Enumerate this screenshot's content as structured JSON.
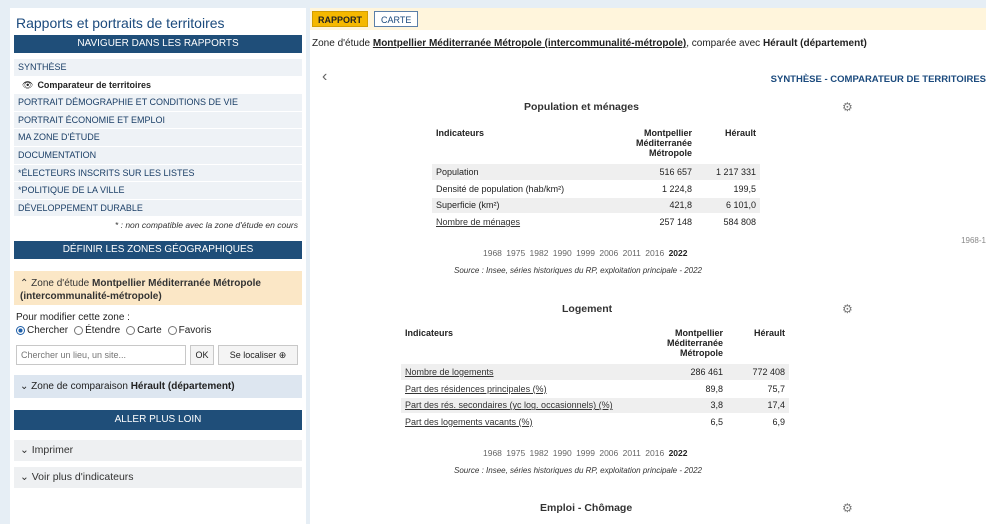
{
  "sidebar": {
    "title": "Rapports et portraits de territoires",
    "nav_header": "NAVIGUER DANS LES RAPPORTS",
    "nav_items": [
      {
        "label": "SYNTHÈSE",
        "type": "main"
      },
      {
        "label": "Comparateur de territoires",
        "type": "sub"
      },
      {
        "label": "PORTRAIT DÉMOGRAPHIE ET CONDITIONS DE VIE",
        "type": "main"
      },
      {
        "label": "PORTRAIT ÉCONOMIE ET EMPLOI",
        "type": "main"
      },
      {
        "label": "MA ZONE D'ÉTUDE",
        "type": "main"
      },
      {
        "label": "DOCUMENTATION",
        "type": "main"
      },
      {
        "label": "*ÉLECTEURS INSCRITS SUR LES LISTES",
        "type": "main"
      },
      {
        "label": "*POLITIQUE DE LA VILLE",
        "type": "main"
      },
      {
        "label": "DÉVELOPPEMENT DURABLE",
        "type": "main"
      }
    ],
    "nav_note": "* : non compatible avec la zone d'étude en cours",
    "zones_header": "DÉFINIR LES ZONES GÉOGRAPHIQUES",
    "zone_study_prefix": "Zone d'étude",
    "zone_study_name": "Montpellier Méditerranée Métropole (intercommunalité-métropole)",
    "modify_label": "Pour modifier cette zone :",
    "radio_options": [
      {
        "label": "Chercher",
        "selected": true
      },
      {
        "label": "Étendre",
        "selected": false
      },
      {
        "label": "Carte",
        "selected": false
      },
      {
        "label": "Favoris",
        "selected": false
      }
    ],
    "search_placeholder": "Chercher un lieu, un site...",
    "ok_button": "OK",
    "locate_button": "Se localiser ⊕",
    "zone_compare_prefix": "Zone de comparaison",
    "zone_compare_name": "Hérault (département)",
    "go_further_header": "ALLER PLUS LOIN",
    "print_label": "Imprimer",
    "more_indicators_label": "Voir plus d'indicateurs"
  },
  "main": {
    "tabs": {
      "rapport": "RAPPORT",
      "carte": "CARTE"
    },
    "zone_line": {
      "prefix": "Zone d'étude",
      "study": "Montpellier Méditerranée Métropole (intercommunalité-métropole)",
      "middle": ", comparée avec",
      "compare": "Hérault (département)"
    },
    "back_icon": "‹",
    "page_title": "SYNTHÈSE - COMPARATEUR DE TERRITOIRES",
    "side_years": "1968-1",
    "population": {
      "title": "Population et ménages",
      "col_indicator": "Indicateurs",
      "col_a": "Montpellier Méditerranée Métropole",
      "col_b": "Hérault",
      "rows": [
        {
          "label": "Population",
          "a": "516 657",
          "b": "1 217 331",
          "link": false
        },
        {
          "label": "Densité de population (hab/km²)",
          "a": "1 224,8",
          "b": "199,5",
          "link": false
        },
        {
          "label": "Superficie (km²)",
          "a": "421,8",
          "b": "6 101,0",
          "link": false
        },
        {
          "label": "Nombre de ménages",
          "a": "257 148",
          "b": "584 808",
          "link": true
        }
      ],
      "years": "1968 1975 1982 1990 1999 2006 2011 2016",
      "year_selected": "2022",
      "source": "Source : Insee, séries historiques du RP, exploitation principale - 2022"
    },
    "logement": {
      "title": "Logement",
      "col_indicator": "Indicateurs",
      "col_a": "Montpellier Méditerranée Métropole",
      "col_b": "Hérault",
      "rows": [
        {
          "label": "Nombre de logements",
          "a": "286 461",
          "b": "772 408",
          "link": true
        },
        {
          "label": "Part des résidences principales (%)",
          "a": "89,8",
          "b": "75,7",
          "link": true
        },
        {
          "label": "Part des rés. secondaires (yc log. occasionnels) (%)",
          "a": "3,8",
          "b": "17,4",
          "link": true
        },
        {
          "label": "Part des logements vacants (%)",
          "a": "6,5",
          "b": "6,9",
          "link": true
        }
      ],
      "years": "1968 1975 1982 1990 1999 2006 2011 2016",
      "year_selected": "2022",
      "source": "Source : Insee, séries historiques du RP, exploitation principale - 2022"
    },
    "emploi": {
      "title": "Emploi - Chômage"
    }
  }
}
